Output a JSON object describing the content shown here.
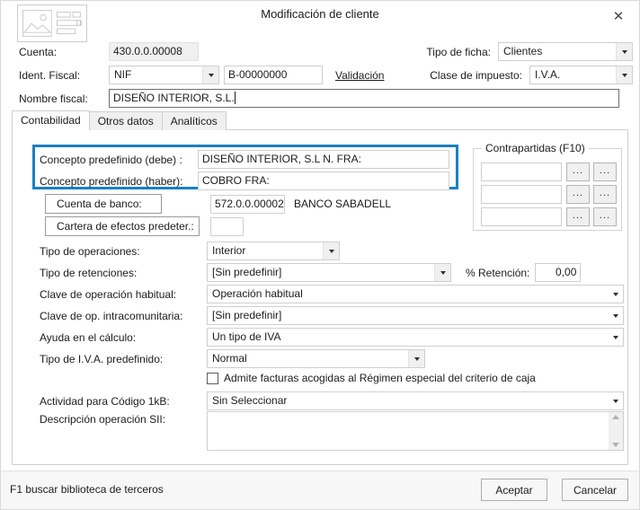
{
  "window": {
    "title": "Modificación de cliente",
    "close_label": "✕",
    "icon_name": "image-placeholder-icon"
  },
  "header": {
    "cuenta_label": "Cuenta:",
    "cuenta_value": "430.0.0.00008",
    "ident_fiscal_label": "Ident. Fiscal:",
    "ident_fiscal_type": "NIF",
    "ident_fiscal_value": "B-00000000",
    "validacion_link": "Validación",
    "nombre_fiscal_label": "Nombre fiscal:",
    "nombre_fiscal_value": "DISEÑO INTERIOR, S.L.",
    "tipo_ficha_label": "Tipo de ficha:",
    "tipo_ficha_value": "Clientes",
    "clase_impuesto_label": "Clase de impuesto:",
    "clase_impuesto_value": "I.V.A."
  },
  "tabs": [
    {
      "label": "Contabilidad",
      "active": true
    },
    {
      "label": "Otros datos",
      "active": false
    },
    {
      "label": "Analíticos",
      "active": false
    }
  ],
  "form": {
    "concepto_debe_label": "Concepto predefinido (debe) :",
    "concepto_debe_value": "DISEÑO INTERIOR, S.L N. FRA:",
    "concepto_haber_label": "Concepto predefinido (haber):",
    "concepto_haber_value": "COBRO FRA:",
    "cuenta_banco_label": "Cuenta de banco:",
    "cuenta_banco_value": "572.0.0.00002",
    "cuenta_banco_desc": "BANCO SABADELL",
    "cartera_label": "Cartera de efectos predeter.:",
    "cartera_value": "",
    "tipo_operaciones_label": "Tipo de operaciones:",
    "tipo_operaciones_value": "Interior",
    "tipo_retenciones_label": "Tipo de retenciones:",
    "tipo_retenciones_value": "[Sin predefinir]",
    "retencion_label": "% Retención:",
    "retencion_value": "0,00",
    "clave_operacion_label": "Clave de operación habitual:",
    "clave_operacion_value": "Operación habitual",
    "clave_intracomunitaria_label": "Clave de op. intracomunitaria:",
    "clave_intracomunitaria_value": "[Sin predefinir]",
    "ayuda_calculo_label": "Ayuda en el cálculo:",
    "ayuda_calculo_value": "Un tipo de IVA",
    "tipo_iva_label": "Tipo de I.V.A. predefinido:",
    "tipo_iva_value": "Normal",
    "criterio_caja_label": "Admite facturas acogidas al Régimen especial del criterio de caja",
    "criterio_caja_checked": false,
    "actividad_label": "Actividad para Código 1kB:",
    "actividad_value": "Sin Seleccionar",
    "descripcion_sii_label": "Descripción operación SII:",
    "descripcion_sii_value": ""
  },
  "contrapartidas": {
    "title": "Contrapartidas (F10)",
    "rows": [
      {
        "value": "",
        "btn1": "...",
        "btn2": "..."
      },
      {
        "value": "",
        "btn1": "...",
        "btn2": "..."
      },
      {
        "value": "",
        "btn1": "...",
        "btn2": "..."
      }
    ]
  },
  "statusbar": {
    "hint": "F1 buscar biblioteca de terceros",
    "accept_label": "Aceptar",
    "cancel_label": "Cancelar"
  },
  "colors": {
    "highlight": "#1a80c4",
    "dialog_bg": "#ffffff",
    "statusbar_bg": "#f7f7f7"
  }
}
